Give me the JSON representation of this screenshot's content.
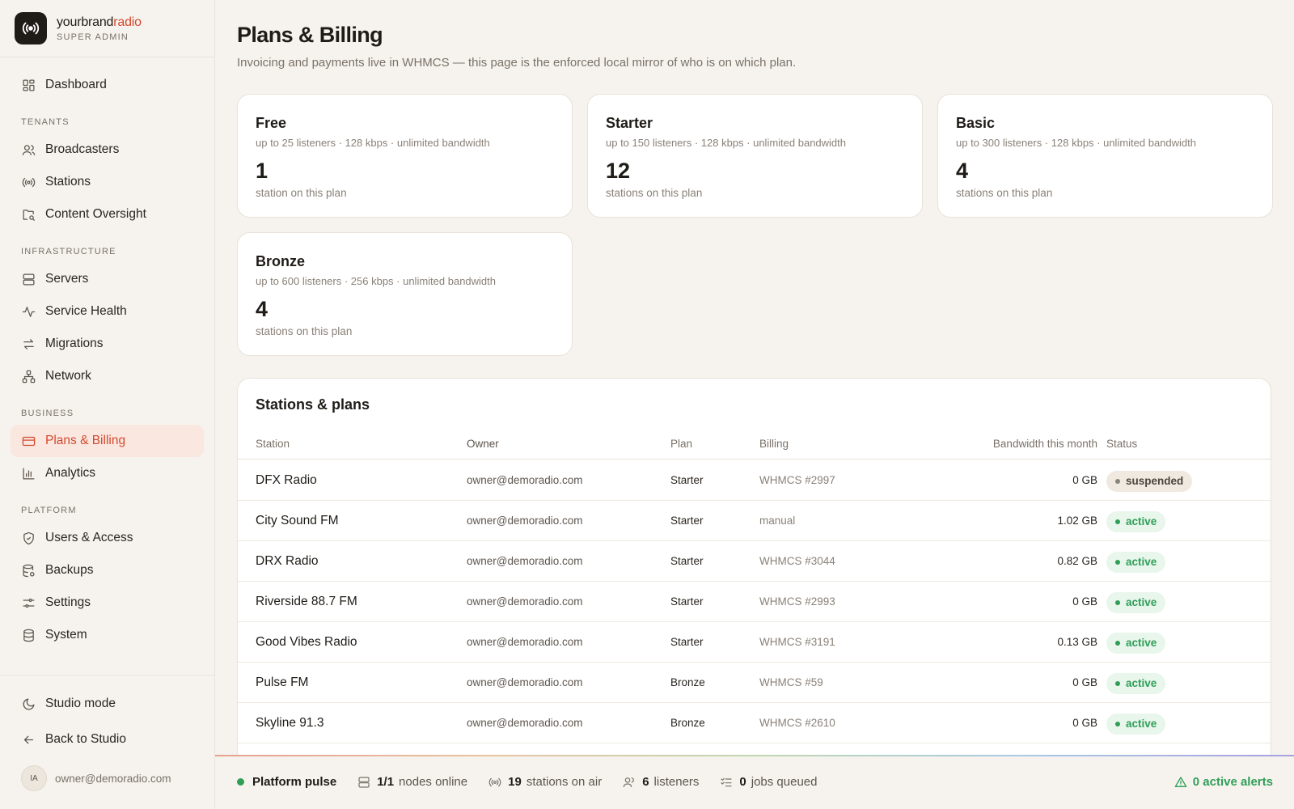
{
  "brand": {
    "name_main": "yourbrand",
    "name_accent": "radio",
    "role": "SUPER ADMIN"
  },
  "sidebar": {
    "dashboard": "Dashboard",
    "sections": {
      "tenants": "TENANTS",
      "infrastructure": "INFRASTRUCTURE",
      "business": "BUSINESS",
      "platform": "PLATFORM"
    },
    "items": {
      "broadcasters": "Broadcasters",
      "stations": "Stations",
      "content_oversight": "Content Oversight",
      "servers": "Servers",
      "service_health": "Service Health",
      "migrations": "Migrations",
      "network": "Network",
      "plans_billing": "Plans & Billing",
      "analytics": "Analytics",
      "users_access": "Users & Access",
      "backups": "Backups",
      "settings": "Settings",
      "system": "System"
    },
    "bottom": {
      "studio_mode": "Studio mode",
      "back_to_studio": "Back to Studio"
    },
    "user": {
      "initials": "IA",
      "email": "owner@demoradio.com"
    }
  },
  "page": {
    "title": "Plans & Billing",
    "subtitle": "Invoicing and payments live in WHMCS — this page is the enforced local mirror of who is on which plan."
  },
  "plans": [
    {
      "name": "Free",
      "desc": "up to 25 listeners · 128 kbps · unlimited bandwidth",
      "count": "1",
      "unit": "station on this plan"
    },
    {
      "name": "Starter",
      "desc": "up to 150 listeners · 128 kbps · unlimited bandwidth",
      "count": "12",
      "unit": "stations on this plan"
    },
    {
      "name": "Basic",
      "desc": "up to 300 listeners · 128 kbps · unlimited bandwidth",
      "count": "4",
      "unit": "stations on this plan"
    },
    {
      "name": "Bronze",
      "desc": "up to 600 listeners · 256 kbps · unlimited bandwidth",
      "count": "4",
      "unit": "stations on this plan"
    }
  ],
  "table": {
    "title": "Stations & plans",
    "headers": {
      "station": "Station",
      "owner": "Owner",
      "plan": "Plan",
      "billing": "Billing",
      "bandwidth": "Bandwidth this month",
      "status": "Status"
    },
    "rows": [
      {
        "station": "DFX Radio",
        "owner": "owner@demoradio.com",
        "plan": "Starter",
        "billing": "WHMCS #2997",
        "bandwidth": "0 GB",
        "status": "suspended"
      },
      {
        "station": "City Sound FM",
        "owner": "owner@demoradio.com",
        "plan": "Starter",
        "billing": "manual",
        "bandwidth": "1.02 GB",
        "status": "active"
      },
      {
        "station": "DRX Radio",
        "owner": "owner@demoradio.com",
        "plan": "Starter",
        "billing": "WHMCS #3044",
        "bandwidth": "0.82 GB",
        "status": "active"
      },
      {
        "station": "Riverside 88.7 FM",
        "owner": "owner@demoradio.com",
        "plan": "Starter",
        "billing": "WHMCS #2993",
        "bandwidth": "0 GB",
        "status": "active"
      },
      {
        "station": "Good Vibes Radio",
        "owner": "owner@demoradio.com",
        "plan": "Starter",
        "billing": "WHMCS #3191",
        "bandwidth": "0.13 GB",
        "status": "active"
      },
      {
        "station": "Pulse FM",
        "owner": "owner@demoradio.com",
        "plan": "Bronze",
        "billing": "WHMCS #59",
        "bandwidth": "0 GB",
        "status": "active"
      },
      {
        "station": "Skyline 91.3",
        "owner": "owner@demoradio.com",
        "plan": "Bronze",
        "billing": "WHMCS #2610",
        "bandwidth": "0 GB",
        "status": "active"
      }
    ]
  },
  "footer": {
    "pulse_label": "Platform pulse",
    "nodes_value": "1/1",
    "nodes_label": "nodes online",
    "stations_value": "19",
    "stations_label": "stations on air",
    "listeners_value": "6",
    "listeners_label": "listeners",
    "jobs_value": "0",
    "jobs_label": "jobs queued",
    "alerts": "0 active alerts"
  },
  "colors": {
    "accent": "#d4492d",
    "active_green": "#2f9e57",
    "background": "#f6f3ee"
  }
}
